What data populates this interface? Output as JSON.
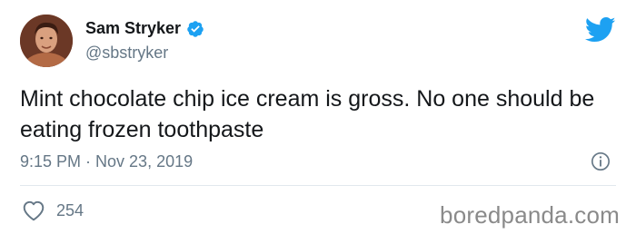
{
  "user": {
    "display_name": "Sam Stryker",
    "handle": "@sbstryker",
    "verified": true,
    "avatar_icon": "avatar-photo"
  },
  "tweet": {
    "text": "Mint chocolate chip ice cream is gross. No one should be eating frozen toothpaste",
    "timestamp": "9:15 PM · Nov 23, 2019"
  },
  "engagement": {
    "likes": "254"
  },
  "icons": {
    "brand": "twitter-bird-icon",
    "verified": "verified-badge-icon",
    "info": "info-icon",
    "like": "heart-icon"
  },
  "colors": {
    "twitter_blue": "#1da1f2",
    "text_primary": "#14171a",
    "text_secondary": "#657786",
    "divider": "#e1e8ed"
  },
  "watermark": {
    "text": "boredpanda.com"
  }
}
